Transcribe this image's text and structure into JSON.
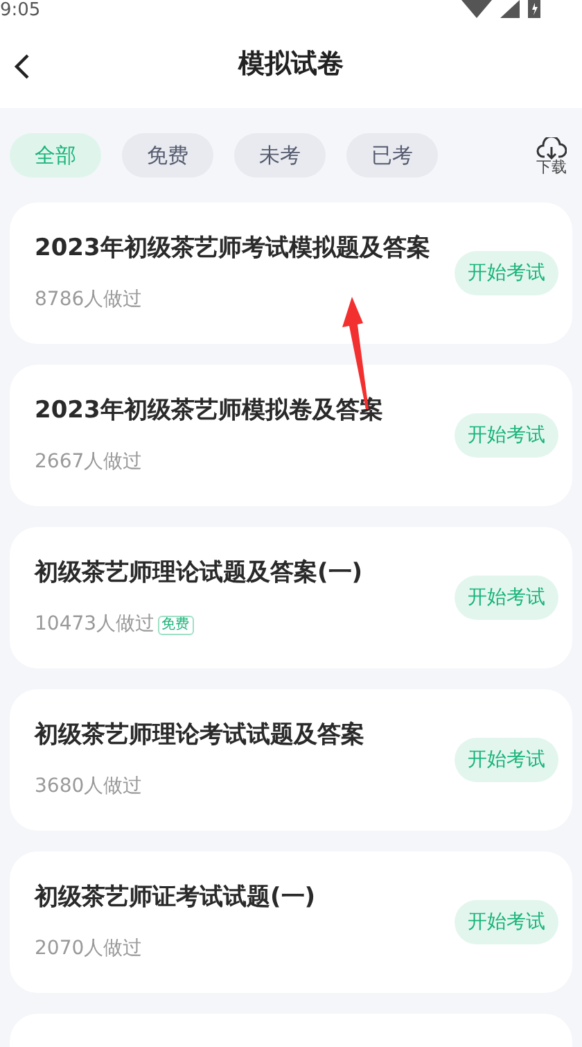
{
  "status_bar": {
    "time": "9:05"
  },
  "header": {
    "title": "模拟试卷"
  },
  "filters": [
    {
      "label": "全部",
      "selected": true
    },
    {
      "label": "免费",
      "selected": false
    },
    {
      "label": "未考",
      "selected": false
    },
    {
      "label": "已考",
      "selected": false
    }
  ],
  "download": {
    "label": "下载"
  },
  "papers": [
    {
      "title": "2023年初级茶艺师考试模拟题及答案",
      "count": "8786人做过",
      "button": "开始考试"
    },
    {
      "title": "2023年初级茶艺师模拟卷及答案",
      "count": "2667人做过",
      "button": "开始考试"
    },
    {
      "title": "初级茶艺师理论试题及答案(一)",
      "count": "10473人做过",
      "tag": "免费",
      "button": "开始考试"
    },
    {
      "title": "初级茶艺师理论考试试题及答案",
      "count": "3680人做过",
      "button": "开始考试"
    },
    {
      "title": "初级茶艺师证考试试题(一)",
      "count": "2070人做过",
      "button": "开始考试"
    }
  ]
}
